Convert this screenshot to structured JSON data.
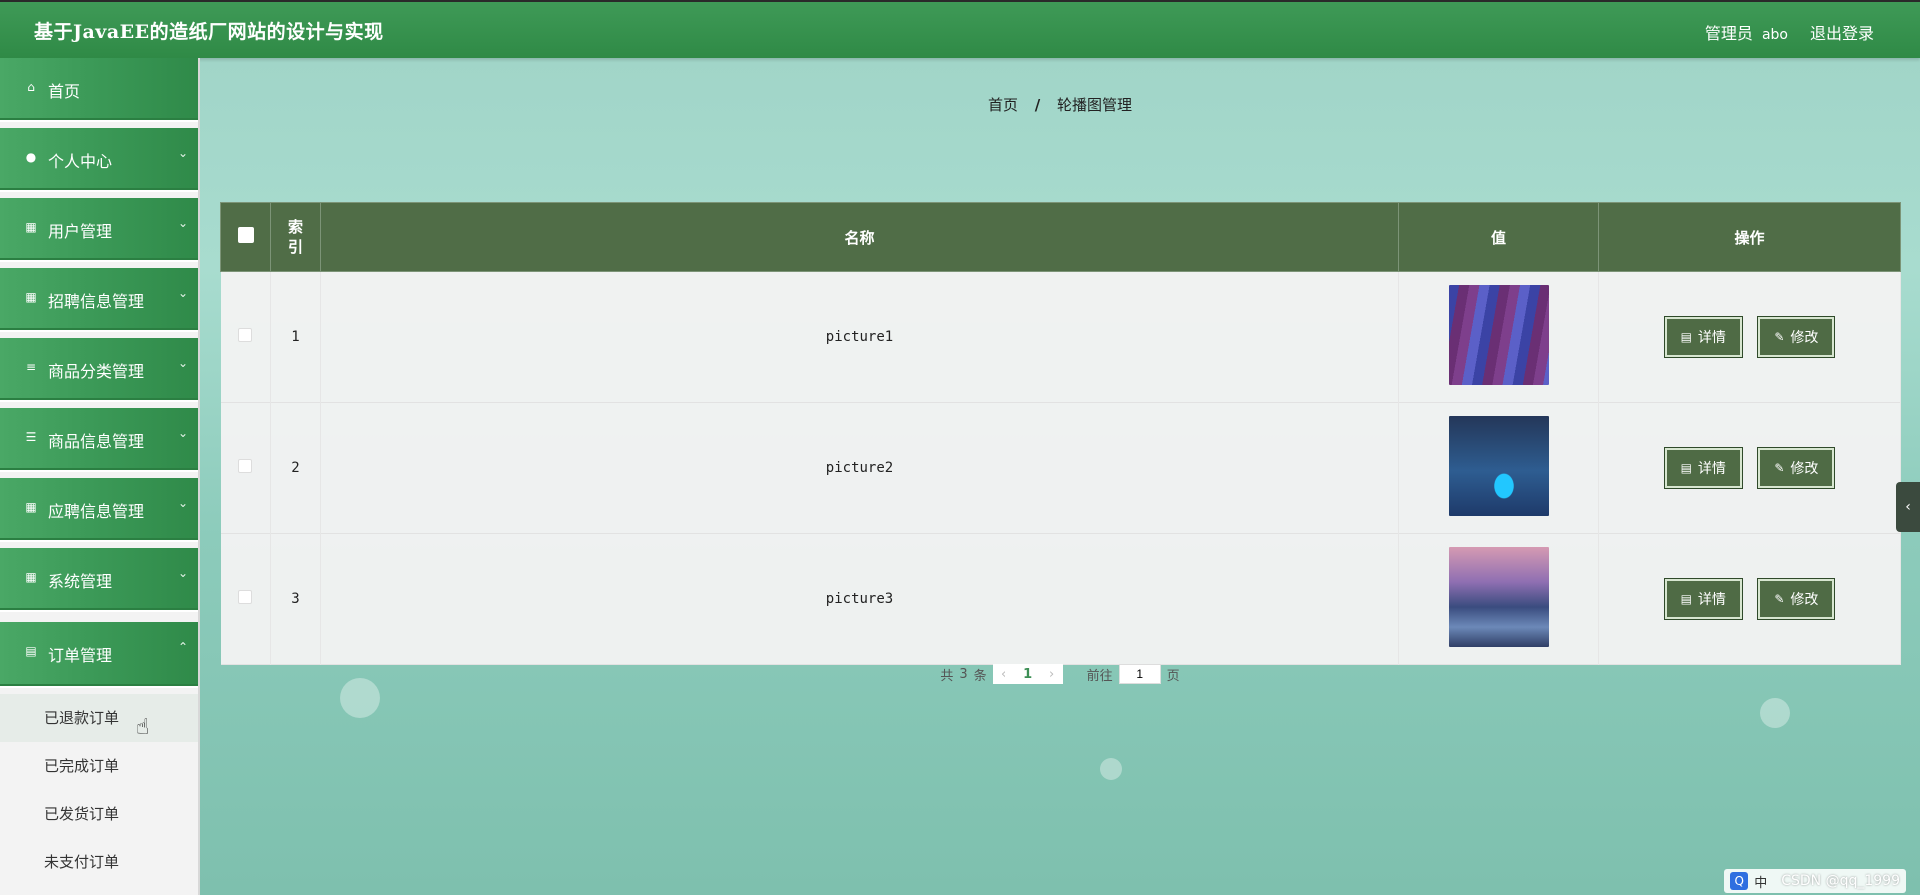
{
  "header": {
    "title": "基于JavaEE的造纸厂网站的设计与实现",
    "user_role": "管理员",
    "user_name": "abo",
    "logout_label": "退出登录"
  },
  "sidebar": {
    "items": [
      {
        "label": "首页",
        "icon": "home-icon"
      },
      {
        "label": "个人中心",
        "icon": "user-icon"
      },
      {
        "label": "用户管理",
        "icon": "grid-icon"
      },
      {
        "label": "招聘信息管理",
        "icon": "grid-icon"
      },
      {
        "label": "商品分类管理",
        "icon": "sliders-icon"
      },
      {
        "label": "商品信息管理",
        "icon": "list-icon"
      },
      {
        "label": "应聘信息管理",
        "icon": "grid-icon"
      },
      {
        "label": "系统管理",
        "icon": "grid-icon"
      }
    ],
    "open_item": {
      "label": "订单管理",
      "icon": "clipboard-icon"
    },
    "submenu": [
      "已退款订单",
      "已完成订单",
      "已发货订单",
      "未支付订单"
    ]
  },
  "breadcrumb": {
    "home": "首页",
    "separator": "/",
    "current": "轮播图管理"
  },
  "table": {
    "headers": {
      "index": "索引",
      "name": "名称",
      "value": "值",
      "actions": "操作"
    },
    "rows": [
      {
        "index": "1",
        "name": "picture1",
        "image": "lavender-field"
      },
      {
        "index": "2",
        "name": "picture2",
        "image": "night-bridge"
      },
      {
        "index": "3",
        "name": "picture3",
        "image": "city-sunset"
      }
    ],
    "detail_label": "详情",
    "edit_label": "修改"
  },
  "pagination": {
    "total_prefix": "共",
    "total_count": "3",
    "total_suffix": "条",
    "current_page": "1",
    "goto_prefix": "前往",
    "goto_value": "1",
    "goto_suffix": "页"
  },
  "taskbar": {
    "ime_label": "中",
    "watermark": "CSDN @qq_1999"
  },
  "colors": {
    "header_green": "#2f8a46",
    "table_header": "#506d47",
    "accent": "#3d8f55"
  }
}
